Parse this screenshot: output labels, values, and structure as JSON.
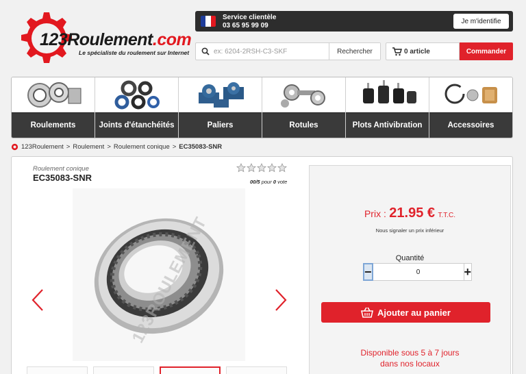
{
  "header": {
    "logo_main": "123Roulement",
    "logo_domain": ".com",
    "tagline": "Le spécialiste du roulement sur Internet",
    "service_title": "Service clientèle",
    "service_phone": "03 65 95 99 09",
    "login_label": "Je m'identifie",
    "search_placeholder": "ex: 6204-2RSH-C3-SKF",
    "search_button": "Rechercher",
    "cart_count": "0",
    "cart_unit": "article",
    "order_button": "Commander"
  },
  "nav": {
    "items": [
      {
        "label": "Roulements",
        "icon": "bearings-image"
      },
      {
        "label": "Joints d'étanchéités",
        "icon": "seals-image"
      },
      {
        "label": "Paliers",
        "icon": "bearing-units-image"
      },
      {
        "label": "Rotules",
        "icon": "rod-ends-image"
      },
      {
        "label": "Plots Antivibration",
        "icon": "anti-vibration-mounts-image"
      },
      {
        "label": "Accessoires",
        "icon": "accessories-image"
      }
    ]
  },
  "breadcrumb": {
    "items": [
      "123Roulement",
      "Roulement",
      "Roulement conique"
    ],
    "current": "EC35083-SNR"
  },
  "product": {
    "category": "Roulement conique",
    "reference": "EC35083-SNR",
    "rating_value": "00/5",
    "rating_for": "pour",
    "rating_votes": "0",
    "rating_vote_label": "vote",
    "rating_stars": 0,
    "watermark": "123ROULEMENT"
  },
  "purchase": {
    "price_label": "Prix :",
    "price_value": "21.95 €",
    "price_tax": "T.T.C.",
    "lower_price_link": "Nous signaler un prix inférieur",
    "quantity_label": "Quantité",
    "quantity_value": "0",
    "minus": "−",
    "plus": "+",
    "add_to_cart": "Ajouter au panier",
    "availability_line1": "Disponible sous 5 à 7 jours",
    "availability_line2": "dans nos locaux"
  },
  "colors": {
    "accent": "#e0222b",
    "dark": "#3a3a3a"
  }
}
